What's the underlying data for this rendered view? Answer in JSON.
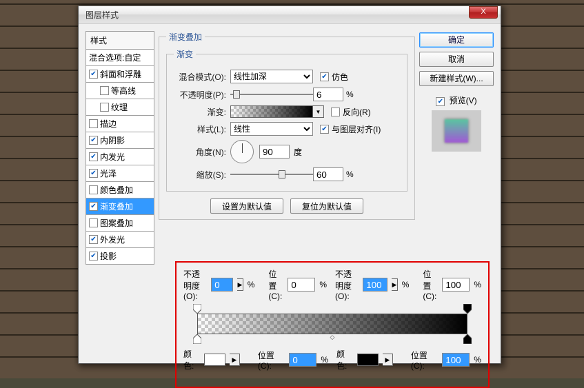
{
  "dialog": {
    "title": "图层样式",
    "close_icon": "X"
  },
  "stylelist": {
    "header": "样式",
    "blend_opts": "混合选项:自定",
    "items": [
      {
        "label": "斜面和浮雕",
        "checked": true,
        "indent": false
      },
      {
        "label": "等高线",
        "checked": false,
        "indent": true
      },
      {
        "label": "纹理",
        "checked": false,
        "indent": true
      },
      {
        "label": "描边",
        "checked": false,
        "indent": false
      },
      {
        "label": "内阴影",
        "checked": true,
        "indent": false
      },
      {
        "label": "内发光",
        "checked": true,
        "indent": false
      },
      {
        "label": "光泽",
        "checked": true,
        "indent": false
      },
      {
        "label": "颜色叠加",
        "checked": false,
        "indent": false
      },
      {
        "label": "渐变叠加",
        "checked": true,
        "indent": false,
        "selected": true
      },
      {
        "label": "图案叠加",
        "checked": false,
        "indent": false
      },
      {
        "label": "外发光",
        "checked": true,
        "indent": false
      },
      {
        "label": "投影",
        "checked": true,
        "indent": false
      }
    ]
  },
  "main": {
    "section_title": "渐变叠加",
    "subsection_title": "渐变",
    "blendmode_label": "混合模式(O):",
    "blendmode_value": "线性加深",
    "dither_label": "仿色",
    "dither_checked": true,
    "opacity_label": "不透明度(P):",
    "opacity_value": "6",
    "pct": "%",
    "gradient_label": "渐变:",
    "reverse_label": "反向(R)",
    "reverse_checked": false,
    "style_label": "样式(L):",
    "style_value": "线性",
    "align_label": "与图层对齐(I)",
    "align_checked": true,
    "angle_label": "角度(N):",
    "angle_value": "90",
    "angle_unit": "度",
    "scale_label": "缩放(S):",
    "scale_value": "60",
    "btn_default": "设置为默认值",
    "btn_reset": "复位为默认值"
  },
  "right": {
    "ok": "确定",
    "cancel": "取消",
    "newstyle": "新建样式(W)...",
    "preview_label": "预览(V)",
    "preview_checked": true
  },
  "editor": {
    "opacity_label_l": "不透明度(O):",
    "opacity_val_l": "0",
    "pos_label": "位置(C):",
    "pos_val_l": "0",
    "opacity_label_r": "不透明度(O):",
    "opacity_val_r": "100",
    "pos_val_r": "100",
    "pct": "%",
    "color_label_l": "颜色:",
    "color_l": "#ffffff",
    "pos_cl": "0",
    "color_label_r": "颜色:",
    "color_r": "#000000",
    "pos_cr": "100"
  }
}
